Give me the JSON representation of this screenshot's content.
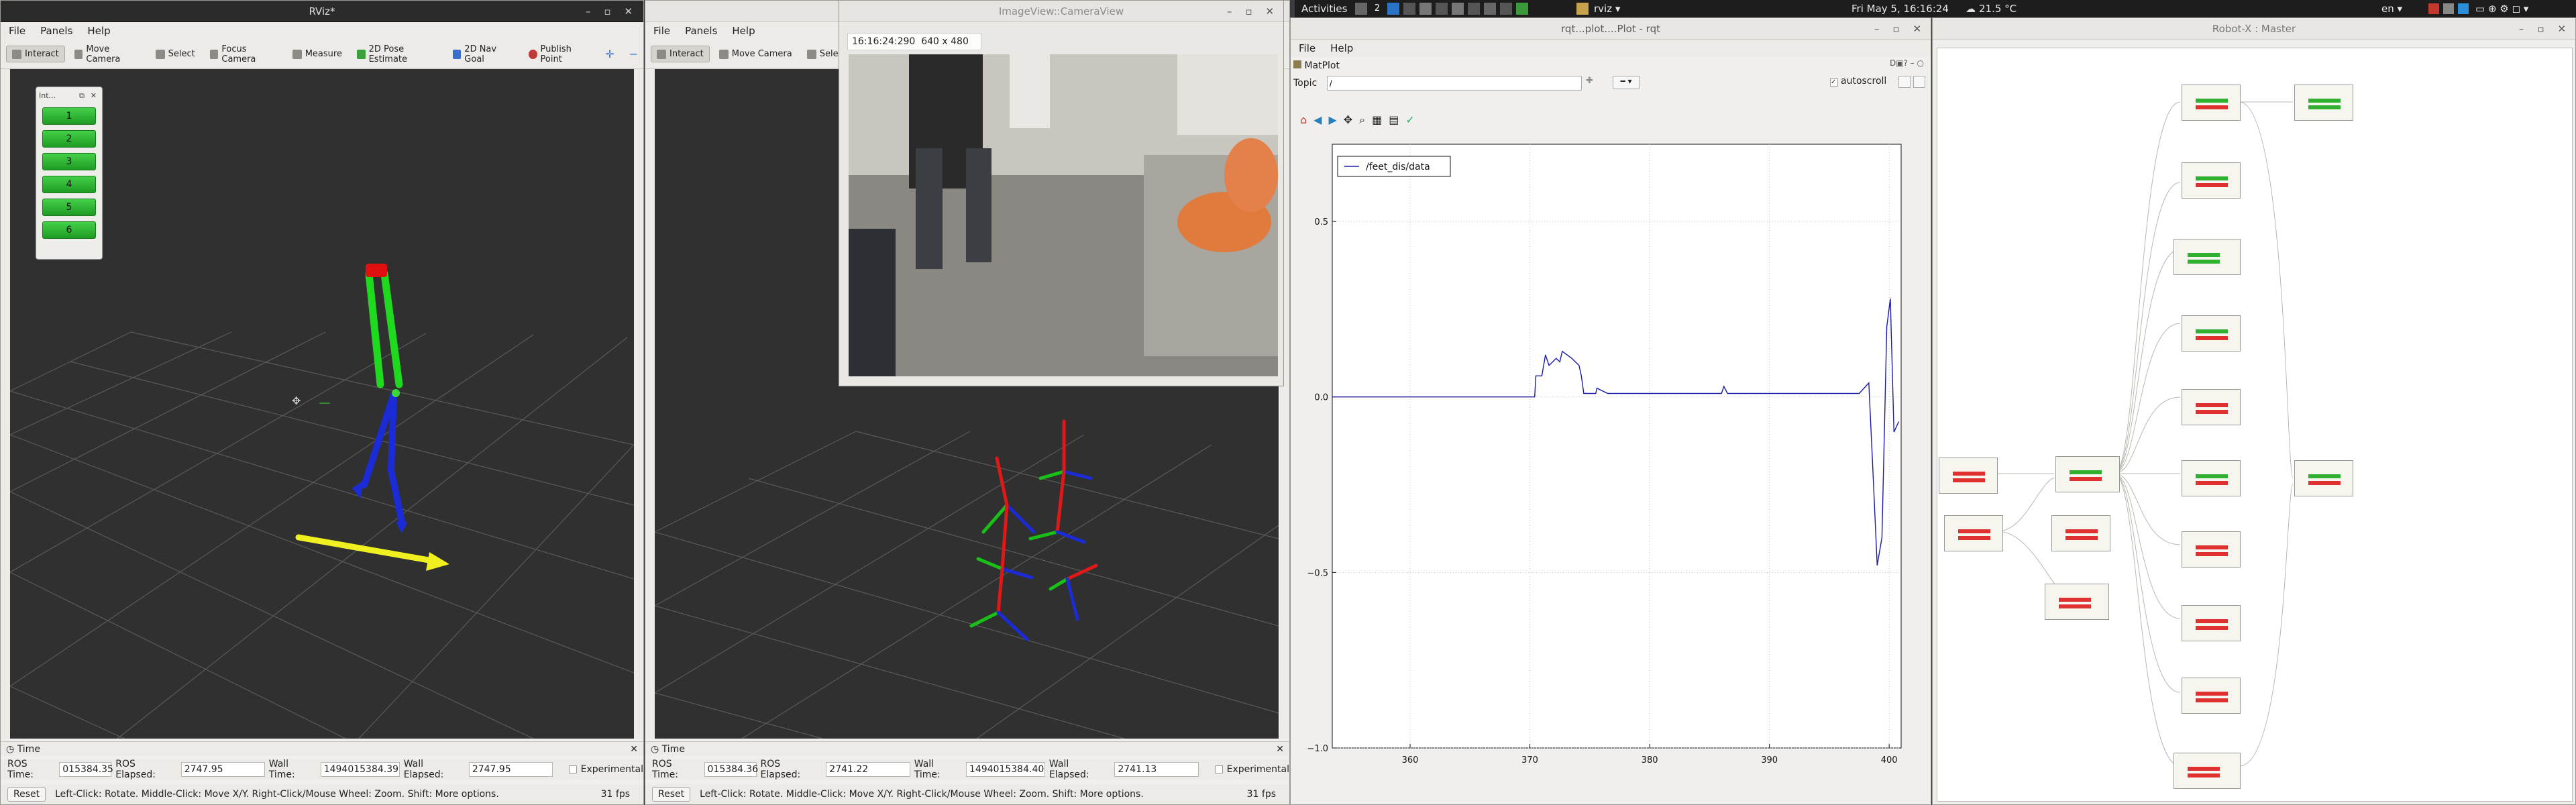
{
  "topbar": {
    "activities": "Activities",
    "workspace": "2",
    "app_menu": "rviz",
    "clock": "Fri May  5, 16:16:24",
    "weather": "21.5 °C",
    "lang": "en"
  },
  "rviz1": {
    "title": "RViz*",
    "menu": [
      "File",
      "Panels",
      "Help"
    ],
    "tools": [
      "Interact",
      "Move Camera",
      "Select",
      "Focus Camera",
      "Measure",
      "2D Pose Estimate",
      "2D Nav Goal",
      "Publish Point"
    ],
    "interact_panel": {
      "title": "Int...",
      "buttons": [
        "1",
        "2",
        "3",
        "4",
        "5",
        "6"
      ]
    },
    "time_label": "Time",
    "status": {
      "ros_time_label": "ROS Time:",
      "ros_time": "015384.35",
      "ros_elapsed_label": "ROS Elapsed:",
      "ros_elapsed": "2747.95",
      "wall_time_label": "Wall Time:",
      "wall_time": "1494015384.39",
      "wall_elapsed_label": "Wall Elapsed:",
      "wall_elapsed": "2747.95",
      "experimental": "Experimental"
    },
    "reset": "Reset",
    "help_text": "Left-Click: Rotate. Middle-Click: Move X/Y. Right-Click/Mouse Wheel: Zoom. Shift: More options.",
    "fps": "31 fps"
  },
  "rviz2": {
    "menu": [
      "File",
      "Panels",
      "Help"
    ],
    "tools": [
      "Interact",
      "Move Camera",
      "Select"
    ],
    "time_label": "Time",
    "status": {
      "ros_time_label": "ROS Time:",
      "ros_time": "015384.36",
      "ros_elapsed_label": "ROS Elapsed:",
      "ros_elapsed": "2741.22",
      "wall_time_label": "Wall Time:",
      "wall_time": "1494015384.40",
      "wall_elapsed_label": "Wall Elapsed:",
      "wall_elapsed": "2741.13",
      "experimental": "Experimental"
    },
    "reset": "Reset",
    "help_text": "Left-Click: Rotate. Middle-Click: Move X/Y. Right-Click/Mouse Wheel: Zoom. Shift: More options.",
    "fps": "31 fps"
  },
  "imageview": {
    "title": "ImageView::CameraView",
    "stamp": "16:16:24:290",
    "size": "640 x 480"
  },
  "rqt": {
    "title": "rqt...plot....Plot - rqt",
    "menu": [
      "File",
      "Help"
    ],
    "plugin": "MatPlot",
    "topic_label": "Topic",
    "topic_value": "/",
    "autoscroll": "autoscroll"
  },
  "chart_data": {
    "type": "line",
    "title": "",
    "xlabel": "",
    "ylabel": "",
    "series": [
      {
        "name": "/feet_dis/data",
        "x": [
          353.5,
          370.4,
          370.5,
          371.0,
          371.3,
          371.6,
          372.2,
          372.5,
          372.7,
          373.5,
          374.1,
          374.3,
          374.5,
          375.5,
          375.6,
          376.5,
          386.0,
          386.2,
          386.5,
          387.0,
          397.5,
          398.3,
          398.6,
          399.0,
          399.4,
          399.8,
          400.1,
          400.4,
          400.8
        ],
        "y": [
          0.0,
          0.0,
          0.06,
          0.06,
          0.12,
          0.09,
          0.11,
          0.1,
          0.13,
          0.11,
          0.09,
          0.06,
          0.01,
          0.01,
          0.025,
          0.01,
          0.01,
          0.03,
          0.01,
          0.01,
          0.01,
          0.04,
          -0.18,
          -0.48,
          -0.4,
          0.2,
          0.28,
          -0.1,
          -0.07
        ]
      }
    ],
    "xlim": [
      353.5,
      401
    ],
    "ylim": [
      -1.0,
      0.72
    ],
    "xticks": [
      "360",
      "370",
      "380",
      "390",
      "400"
    ],
    "yticks": [
      "0.5",
      "0.0",
      "−0.5",
      "−1.0"
    ],
    "legend": "top-left",
    "grid": true
  },
  "robotx": {
    "title": "Robot-X : Master"
  }
}
